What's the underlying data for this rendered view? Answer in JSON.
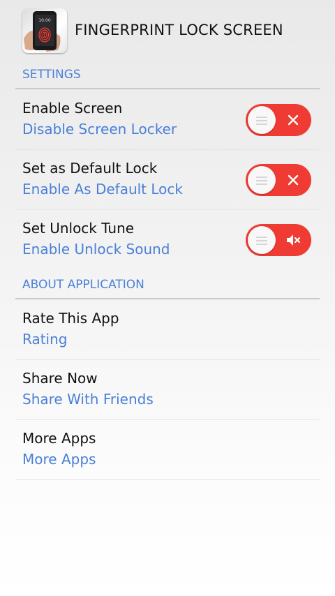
{
  "header": {
    "app_title": "FINGERPRINT LOCK SCREEN",
    "app_icon": "fingerprint-phone-app-icon"
  },
  "sections": {
    "settings": {
      "label": "SETTINGS",
      "items": [
        {
          "title": "Enable Screen",
          "summary": "Disable Screen Locker",
          "toggle_state": "off",
          "toggle_icon": "close-icon"
        },
        {
          "title": "Set as Default Lock",
          "summary": "Enable As Default Lock",
          "toggle_state": "off",
          "toggle_icon": "close-icon"
        },
        {
          "title": "Set Unlock Tune",
          "summary": "Enable Unlock Sound",
          "toggle_state": "off",
          "toggle_icon": "mute-speaker-icon"
        }
      ]
    },
    "about": {
      "label": "ABOUT APPLICATION",
      "items": [
        {
          "title": "Rate This App",
          "summary": "Rating"
        },
        {
          "title": "Share Now",
          "summary": "Share With Friends"
        },
        {
          "title": "More Apps",
          "summary": "More Apps"
        }
      ]
    }
  },
  "colors": {
    "accent_text": "#4a7fd8",
    "toggle_off": "#ef3b33",
    "divider": "#c9c9c9"
  }
}
